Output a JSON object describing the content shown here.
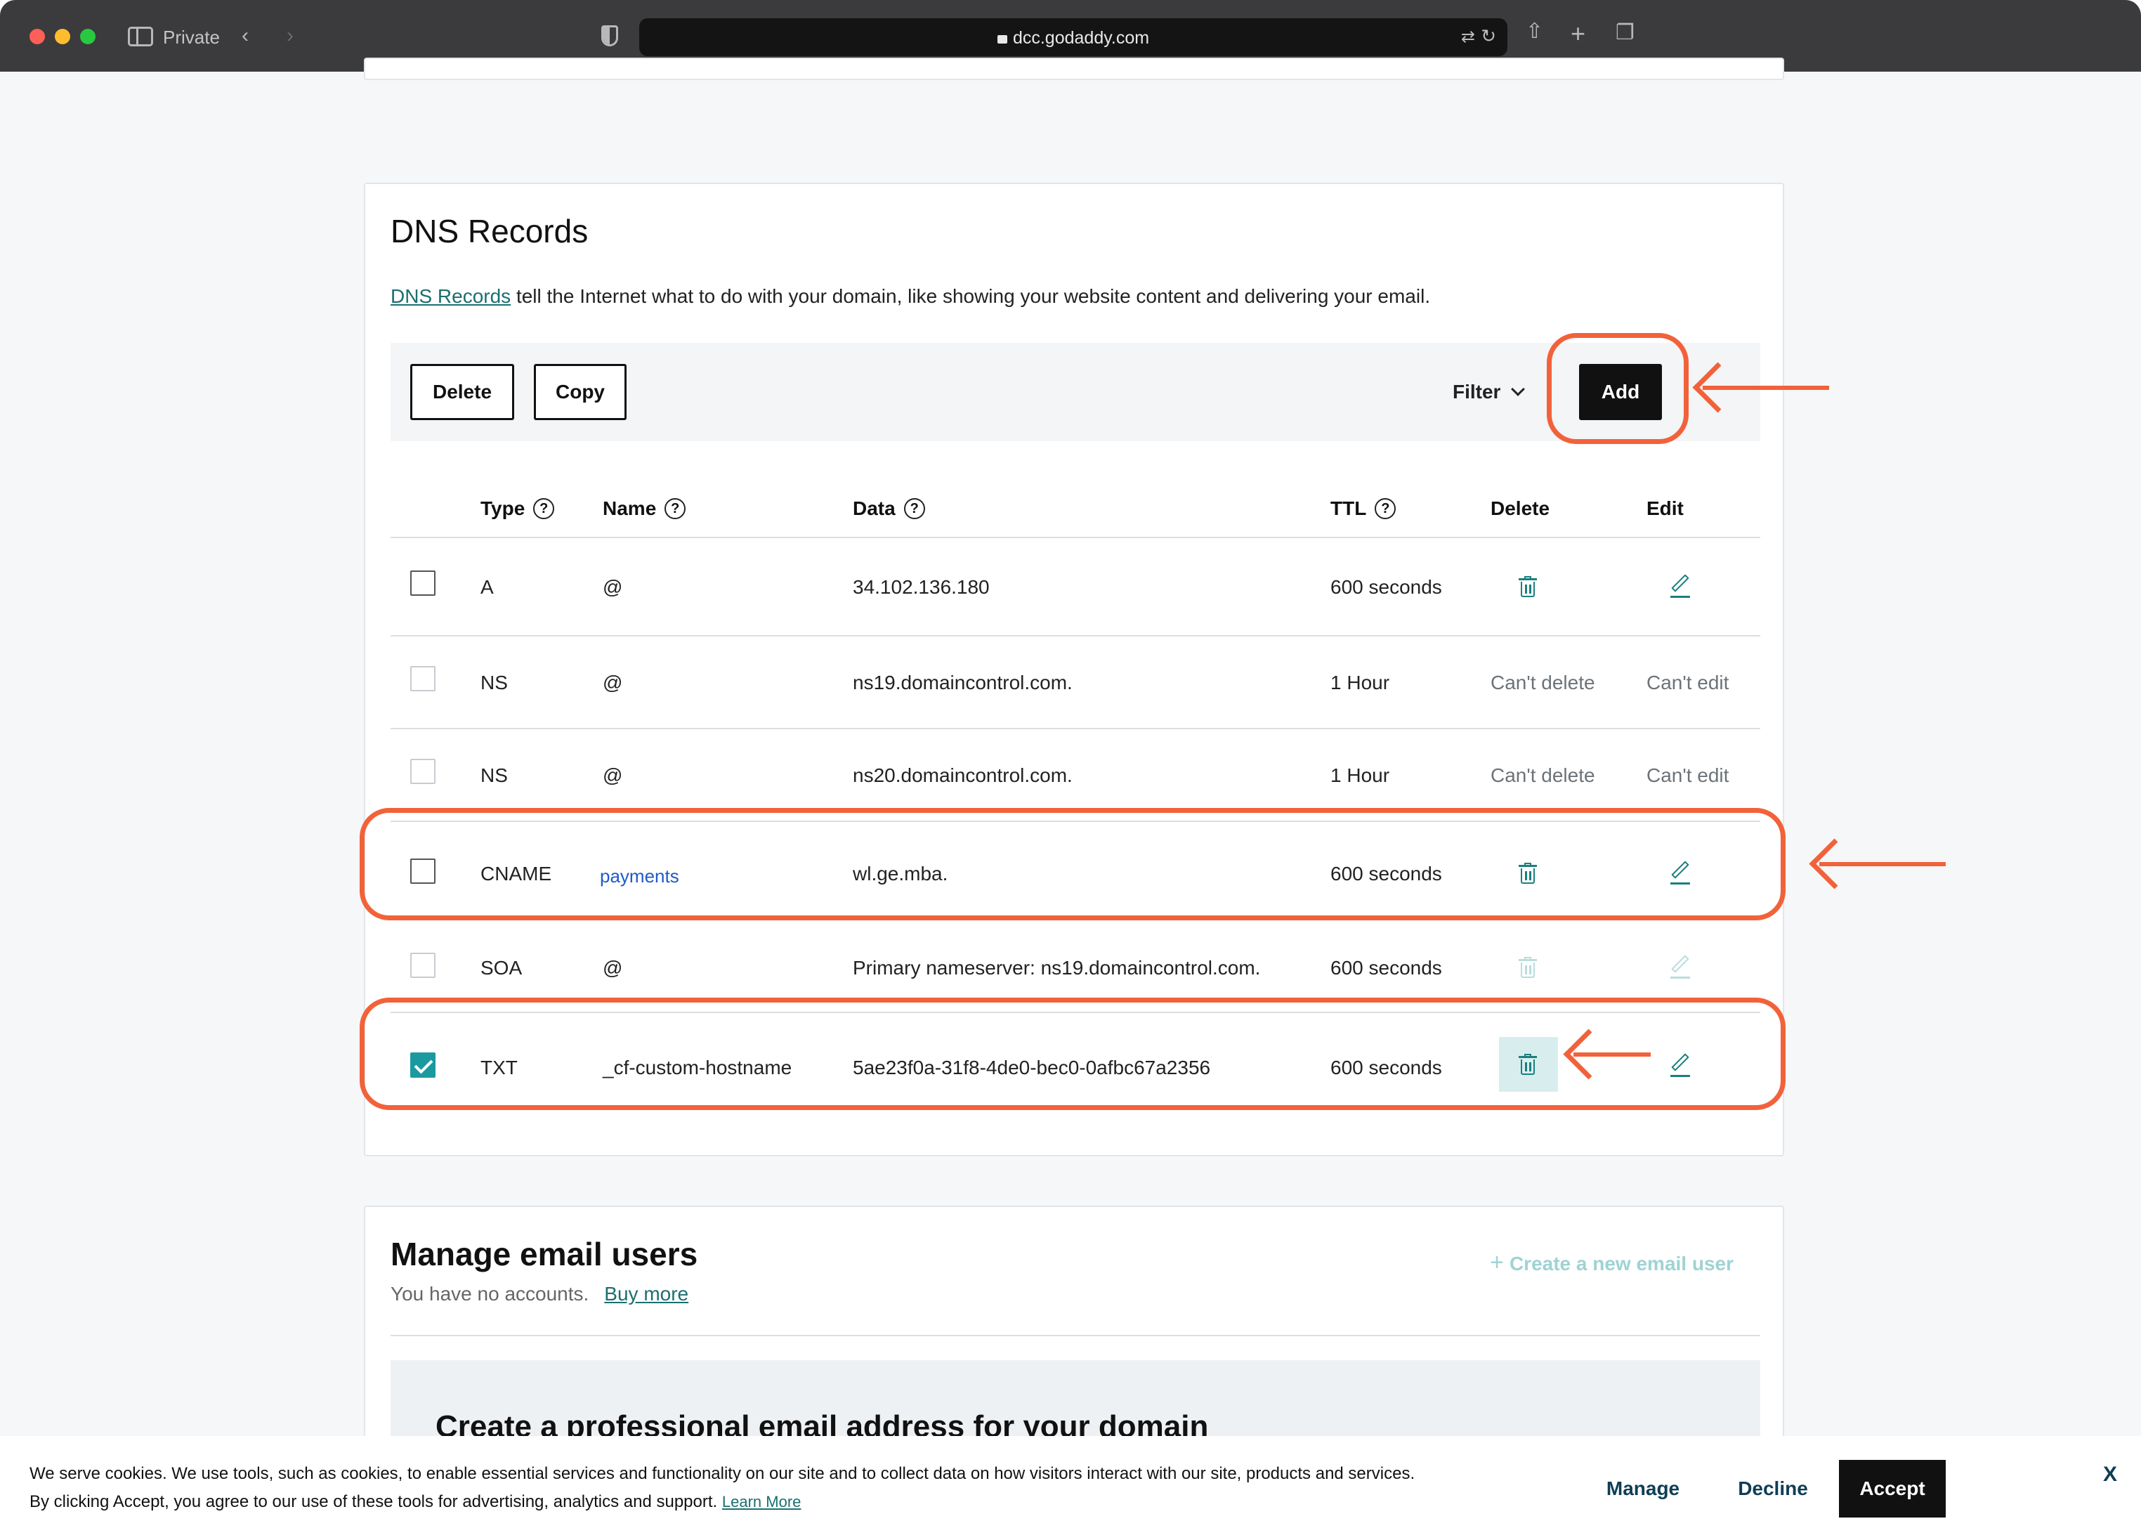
{
  "browser": {
    "private_label": "Private",
    "url": "dcc.godaddy.com"
  },
  "dns": {
    "title": "DNS Records",
    "desc_link": "DNS Records",
    "desc_text": " tell the Internet what to do with your domain, like showing your website content and delivering your email.",
    "toolbar": {
      "delete_label": "Delete",
      "copy_label": "Copy",
      "filter_label": "Filter",
      "add_label": "Add"
    },
    "columns": {
      "type": "Type",
      "name": "Name",
      "data": "Data",
      "ttl": "TTL",
      "delete": "Delete",
      "edit": "Edit"
    },
    "rows": [
      {
        "type": "A",
        "name": "@",
        "data": "34.102.136.180",
        "ttl": "600 seconds",
        "delete": "",
        "edit": "",
        "checked": false
      },
      {
        "type": "NS",
        "name": "@",
        "data": "ns19.domaincontrol.com.",
        "ttl": "1 Hour",
        "delete": "Can't delete",
        "edit": "Can't edit",
        "checked": false
      },
      {
        "type": "NS",
        "name": "@",
        "data": "ns20.domaincontrol.com.",
        "ttl": "1 Hour",
        "delete": "Can't delete",
        "edit": "Can't edit",
        "checked": false
      },
      {
        "type": "CNAME",
        "name": "payments",
        "data": "wl.ge.mba.",
        "ttl": "600 seconds",
        "delete": "",
        "edit": "",
        "checked": false
      },
      {
        "type": "SOA",
        "name": "@",
        "data": "Primary nameserver: ns19.domaincontrol.com.",
        "ttl": "600 seconds",
        "delete": "",
        "edit": "",
        "checked": false
      },
      {
        "type": "TXT",
        "name": "_cf-custom-hostname",
        "data": "5ae23f0a-31f8-4de0-bec0-0afbc67a2356",
        "ttl": "600 seconds",
        "delete": "",
        "edit": "",
        "checked": true
      }
    ]
  },
  "email": {
    "title": "Manage email users",
    "subtitle": "You have no accounts.",
    "buy_more": "Buy more",
    "create_user": "Create a new email user",
    "promo_title": "Create a professional email address for your domain"
  },
  "cookie": {
    "text": "We serve cookies. We use tools, such as cookies, to enable essential services and functionality on our site and to collect data on how visitors interact with our site, products and services. By clicking Accept, you agree to our use of these tools for advertising, analytics and support.",
    "learn_more": "Learn More",
    "manage": "Manage",
    "decline": "Decline",
    "accept": "Accept",
    "close": "X"
  },
  "colors": {
    "accent_teal": "#1b7f7f",
    "annotation": "#f2623a",
    "checkbox_checked": "#1a9aa0"
  }
}
